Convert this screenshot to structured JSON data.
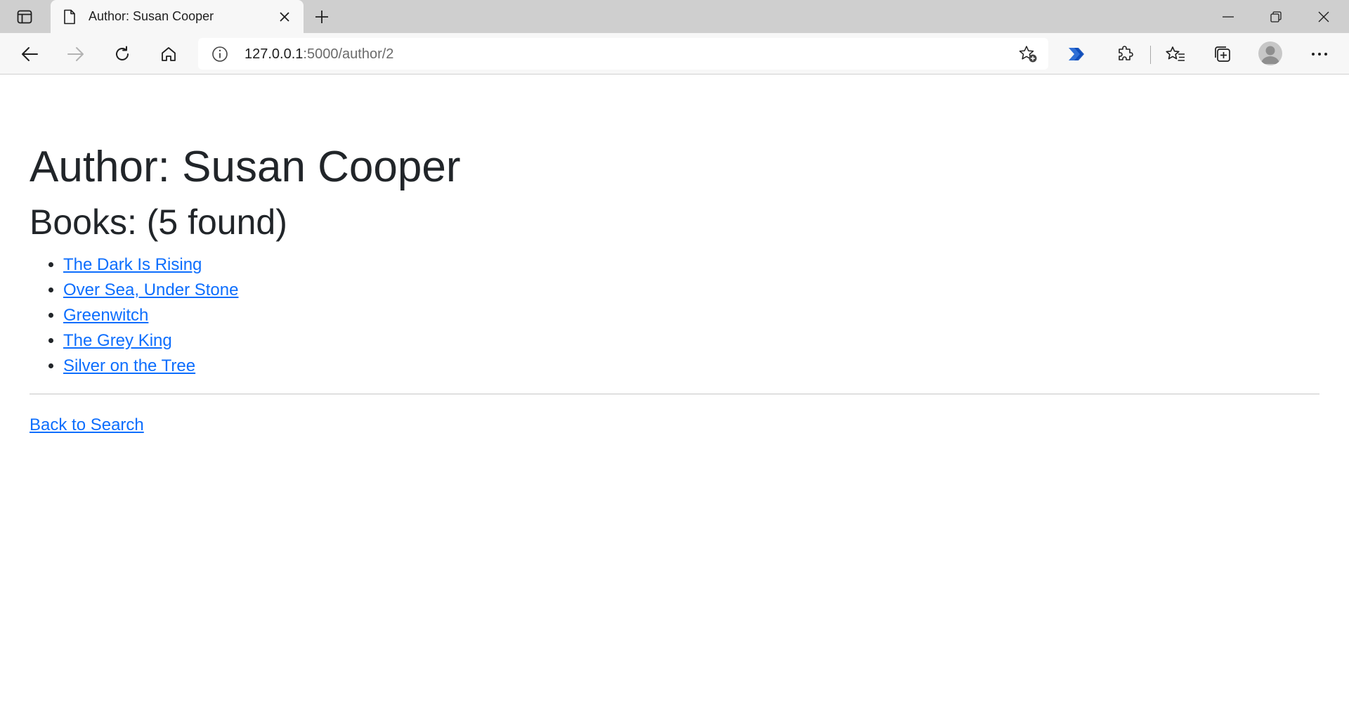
{
  "browser": {
    "tab": {
      "title": "Author: Susan Cooper"
    },
    "address": {
      "host": "127.0.0.1",
      "path": ":5000/author/2"
    },
    "icons": {
      "tab_actions": "tab-actions-icon",
      "favicon": "document-icon",
      "close": "close-icon",
      "new_tab": "plus-icon",
      "back": "back-arrow-icon",
      "forward": "forward-arrow-icon",
      "refresh": "refresh-icon",
      "home": "home-icon",
      "info": "info-icon",
      "add_favorite": "star-plus-icon",
      "power_automate": "power-automate-icon",
      "extensions": "puzzle-icon",
      "favorites": "favorites-icon",
      "collections": "collections-icon",
      "profile": "avatar-icon",
      "menu": "more-icon"
    }
  },
  "page": {
    "title": "Author: Susan Cooper",
    "books_heading": "Books: (5 found)",
    "books": [
      {
        "title": "The Dark Is Rising"
      },
      {
        "title": "Over Sea, Under Stone"
      },
      {
        "title": "Greenwitch"
      },
      {
        "title": "The Grey King"
      },
      {
        "title": "Silver on the Tree"
      }
    ],
    "back_link": "Back to Search"
  },
  "colors": {
    "link": "#0d6efd",
    "text": "#212529",
    "tabstrip": "#cfcfcf",
    "toolbar": "#f7f7f7"
  }
}
